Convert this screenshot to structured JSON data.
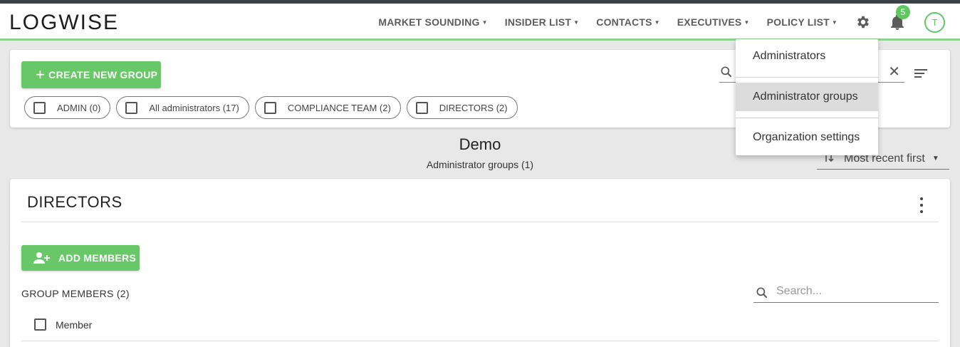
{
  "app": {
    "logo": "LOGWISE"
  },
  "nav": {
    "items": [
      {
        "label": "MARKET SOUNDING"
      },
      {
        "label": "INSIDER LIST"
      },
      {
        "label": "CONTACTS"
      },
      {
        "label": "EXECUTIVES"
      },
      {
        "label": "POLICY LIST"
      }
    ],
    "notification_count": "5",
    "avatar_initial": "T"
  },
  "toolbar": {
    "create_label": "CREATE NEW GROUP",
    "chips": [
      {
        "label": "ADMIN (0)"
      },
      {
        "label": "All administrators (17)"
      },
      {
        "label": "COMPLIANCE TEAM (2)"
      },
      {
        "label": "DIRECTORS (2)"
      }
    ]
  },
  "page": {
    "title": "Demo",
    "subtitle": "Administrator groups (1)",
    "sort_label": "Most recent first"
  },
  "group": {
    "name": "DIRECTORS",
    "add_members_label": "ADD MEMBERS",
    "members_label": "GROUP MEMBERS (2)",
    "search_placeholder": "Search...",
    "column_member": "Member"
  },
  "settings_menu": {
    "items": [
      {
        "label": "Administrators",
        "active": false
      },
      {
        "label": "Administrator groups",
        "active": true
      },
      {
        "label": "Organization settings",
        "active": false
      }
    ]
  },
  "colors": {
    "accent": "#68c868",
    "header_stripe": "#3a4147"
  }
}
